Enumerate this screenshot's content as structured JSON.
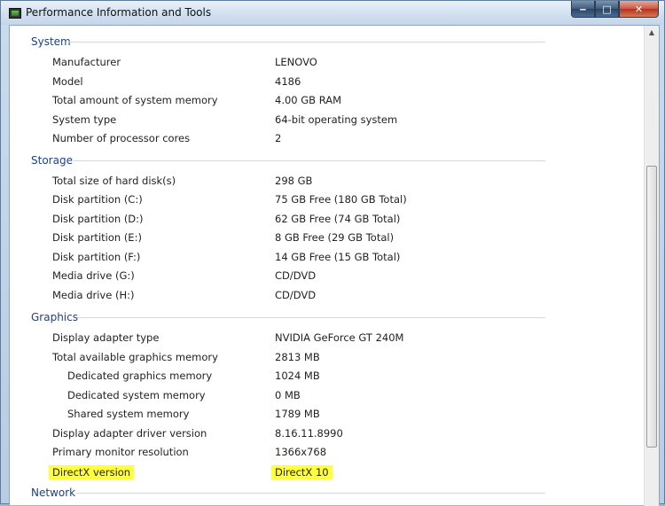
{
  "window": {
    "title": "Performance Information and Tools",
    "minimize_label": "‒",
    "maximize_label": "□",
    "close_label": "✕"
  },
  "sections": [
    {
      "title": "System",
      "rows": [
        {
          "label": "Manufacturer",
          "value": "LENOVO"
        },
        {
          "label": "Model",
          "value": "4186"
        },
        {
          "label": "Total amount of system memory",
          "value": "4.00 GB RAM"
        },
        {
          "label": "System type",
          "value": "64-bit operating system"
        },
        {
          "label": "Number of processor cores",
          "value": "2"
        }
      ]
    },
    {
      "title": "Storage",
      "rows": [
        {
          "label": "Total size of hard disk(s)",
          "value": "298 GB"
        },
        {
          "label": "Disk partition (C:)",
          "value": "75 GB Free (180 GB Total)"
        },
        {
          "label": "Disk partition (D:)",
          "value": "62 GB Free (74 GB Total)"
        },
        {
          "label": "Disk partition (E:)",
          "value": "8 GB Free (29 GB Total)"
        },
        {
          "label": "Disk partition (F:)",
          "value": "14 GB Free (15 GB Total)"
        },
        {
          "label": "Media drive (G:)",
          "value": "CD/DVD"
        },
        {
          "label": "Media drive (H:)",
          "value": "CD/DVD"
        }
      ]
    },
    {
      "title": "Graphics",
      "rows": [
        {
          "label": "Display adapter type",
          "value": "NVIDIA GeForce GT 240M"
        },
        {
          "label": "Total available graphics memory",
          "value": "2813 MB"
        },
        {
          "label": "Dedicated graphics memory",
          "value": "1024 MB"
        },
        {
          "label": "Dedicated system memory",
          "value": "0 MB"
        },
        {
          "label": "Shared system memory",
          "value": "1789 MB"
        },
        {
          "label": "Display adapter driver version",
          "value": "8.16.11.8990"
        },
        {
          "label": "Primary monitor resolution",
          "value": "1366x768"
        },
        {
          "label": "DirectX version",
          "value": "DirectX 10"
        }
      ]
    },
    {
      "title": "Network",
      "rows": []
    }
  ],
  "highlight_color": "#ffff3c",
  "section_title_color": "#1e3f8a"
}
